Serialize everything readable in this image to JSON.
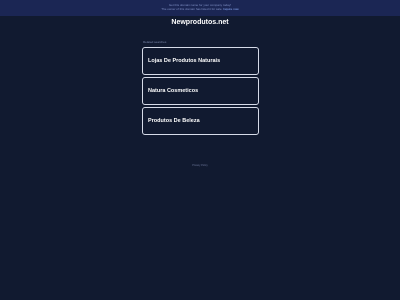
{
  "banner": {
    "line1": "Get this domain name for your company today!",
    "line2": "The owner of this domain has listed it for sale.",
    "cta": "Inquire now"
  },
  "site": {
    "title": "Newprodutos.net"
  },
  "results": {
    "label": "Related searches",
    "items": [
      {
        "label": "Lojas De Produtos Naturais"
      },
      {
        "label": "Natura Cosmeticos"
      },
      {
        "label": "Produtos De Beleza"
      }
    ]
  },
  "footer": {
    "privacy": "Privacy Policy"
  },
  "colors": {
    "background": "#111a30",
    "banner": "#1b2654",
    "result_border": "#d6dbe8"
  }
}
